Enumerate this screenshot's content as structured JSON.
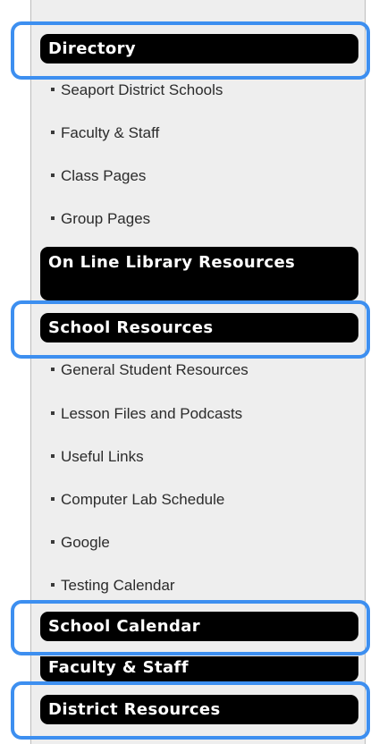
{
  "sidebar": {
    "directory_header": "Directory",
    "directory_links": [
      "Seaport District Schools",
      "Faculty & Staff",
      "Class Pages",
      "Group Pages"
    ],
    "library_header": "On Line Library Resources",
    "school_resources_header": "School Resources",
    "school_resources_links": [
      "General Student Resources",
      "Lesson Files and Podcasts",
      "Useful Links",
      "Computer Lab Schedule",
      "Google",
      "Testing Calendar"
    ],
    "school_calendar_header": "School Calendar",
    "faculty_staff_header": "Faculty & Staff",
    "district_resources_header": "District Resources"
  },
  "colors": {
    "header_bg": "#000000",
    "header_text": "#ffffff",
    "sidebar_bg": "#eeeeee",
    "highlight": "#3d8ff0"
  }
}
